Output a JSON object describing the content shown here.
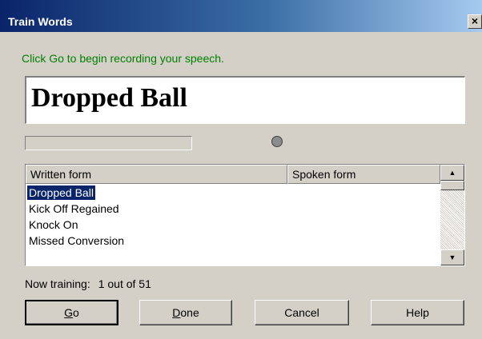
{
  "window": {
    "title": "Train Words",
    "close_glyph": "×"
  },
  "instruction": "Click Go to begin recording your speech.",
  "current_word": "Dropped Ball",
  "audio_level": 0.0,
  "list": {
    "columns": [
      "Written form",
      "Spoken form"
    ],
    "rows": [
      {
        "written": "Dropped Ball",
        "spoken": "",
        "selected": true
      },
      {
        "written": "Kick Off Regained",
        "spoken": "",
        "selected": false
      },
      {
        "written": "Knock On",
        "spoken": "",
        "selected": false
      },
      {
        "written": "Missed Conversion",
        "spoken": "",
        "selected": false
      }
    ],
    "scroll_up_glyph": "▲",
    "scroll_down_glyph": "▼"
  },
  "progress": {
    "label": "Now training:",
    "count_text": "1 out of 51"
  },
  "buttons": {
    "go": {
      "accel": "G",
      "rest": "o"
    },
    "done": {
      "accel": "D",
      "rest": "one"
    },
    "cancel": "Cancel",
    "help": "Help"
  },
  "colors": {
    "instruction_text": "#008000",
    "selection": "#0a246a"
  }
}
